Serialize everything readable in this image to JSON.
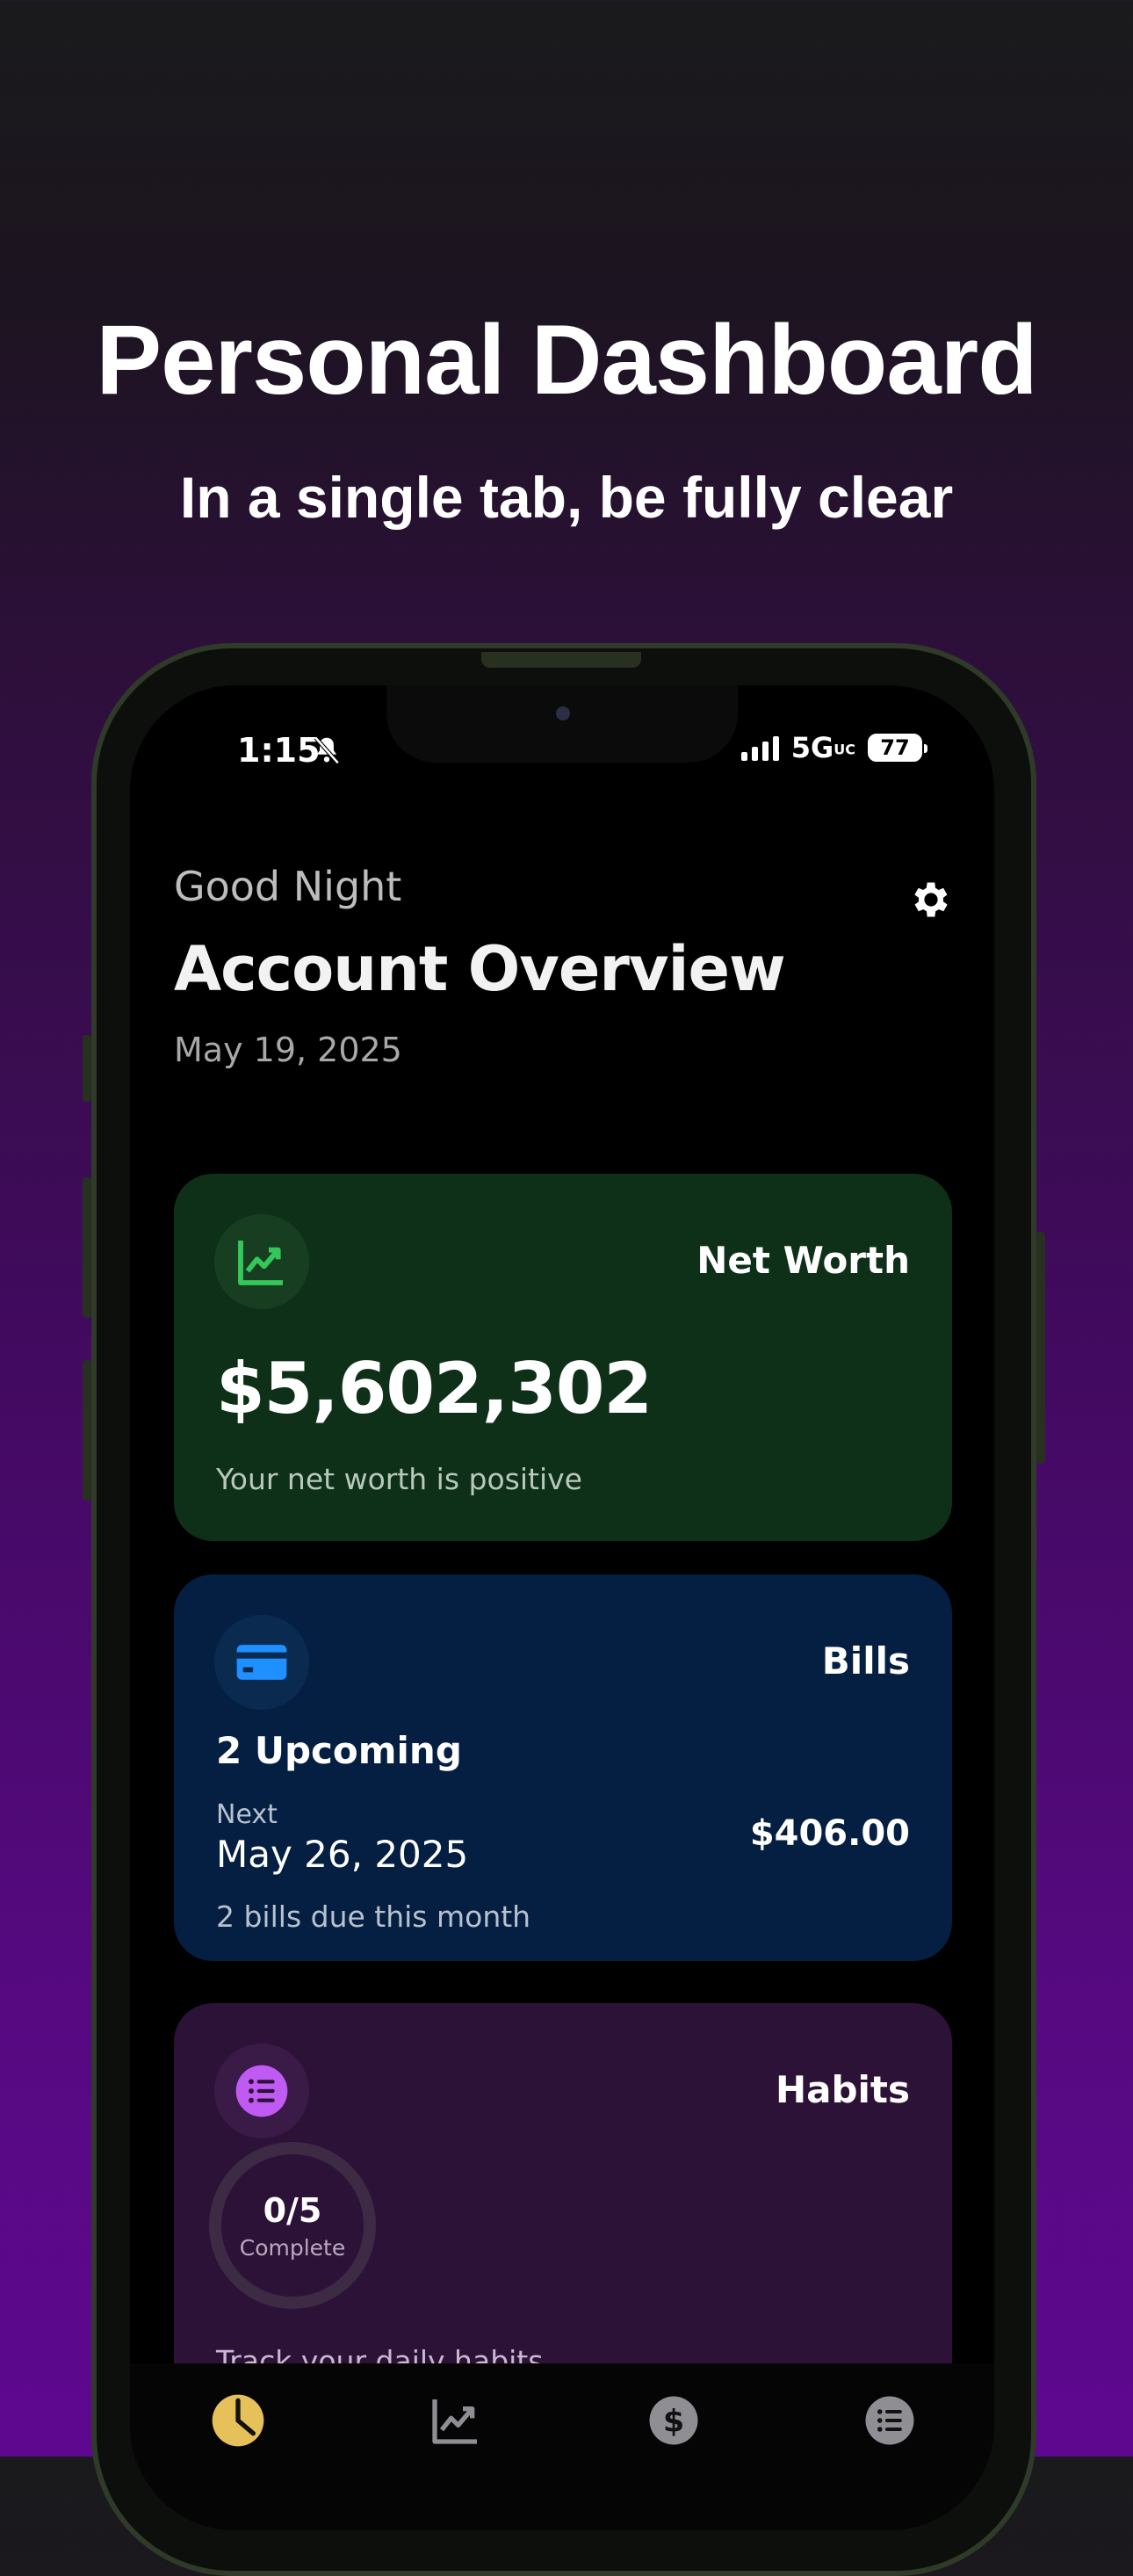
{
  "promo": {
    "headline": "Personal Dashboard",
    "subline": "In a single tab, be fully clear"
  },
  "status_bar": {
    "time": "1:15",
    "network": "5G",
    "network_badge": "UC",
    "battery": "77"
  },
  "header": {
    "greeting": "Good Night",
    "title": "Account Overview",
    "date": "May 19, 2025"
  },
  "net_worth": {
    "label": "Net Worth",
    "amount": "$5,602,302",
    "note": "Your net worth is positive",
    "accent": "#34c759"
  },
  "bills": {
    "label": "Bills",
    "upcoming": "2 Upcoming",
    "next_label": "Next",
    "next_date": "May 26, 2025",
    "next_amount": "$406.00",
    "note": "2 bills due this month",
    "accent": "#1e90ff"
  },
  "habits": {
    "label": "Habits",
    "progress_value": "0/5",
    "progress_label": "Complete",
    "progress_fraction": 0,
    "note": "Track your daily habits",
    "accent": "#bf5af2"
  },
  "tab_bar": {
    "items": [
      {
        "name": "overview",
        "icon": "pie-chart-icon",
        "active": true,
        "color": "#e6c15a"
      },
      {
        "name": "trends",
        "icon": "chart-line-icon",
        "active": false
      },
      {
        "name": "money",
        "icon": "dollar-icon",
        "active": false
      },
      {
        "name": "list",
        "icon": "list-icon",
        "active": false
      }
    ]
  }
}
